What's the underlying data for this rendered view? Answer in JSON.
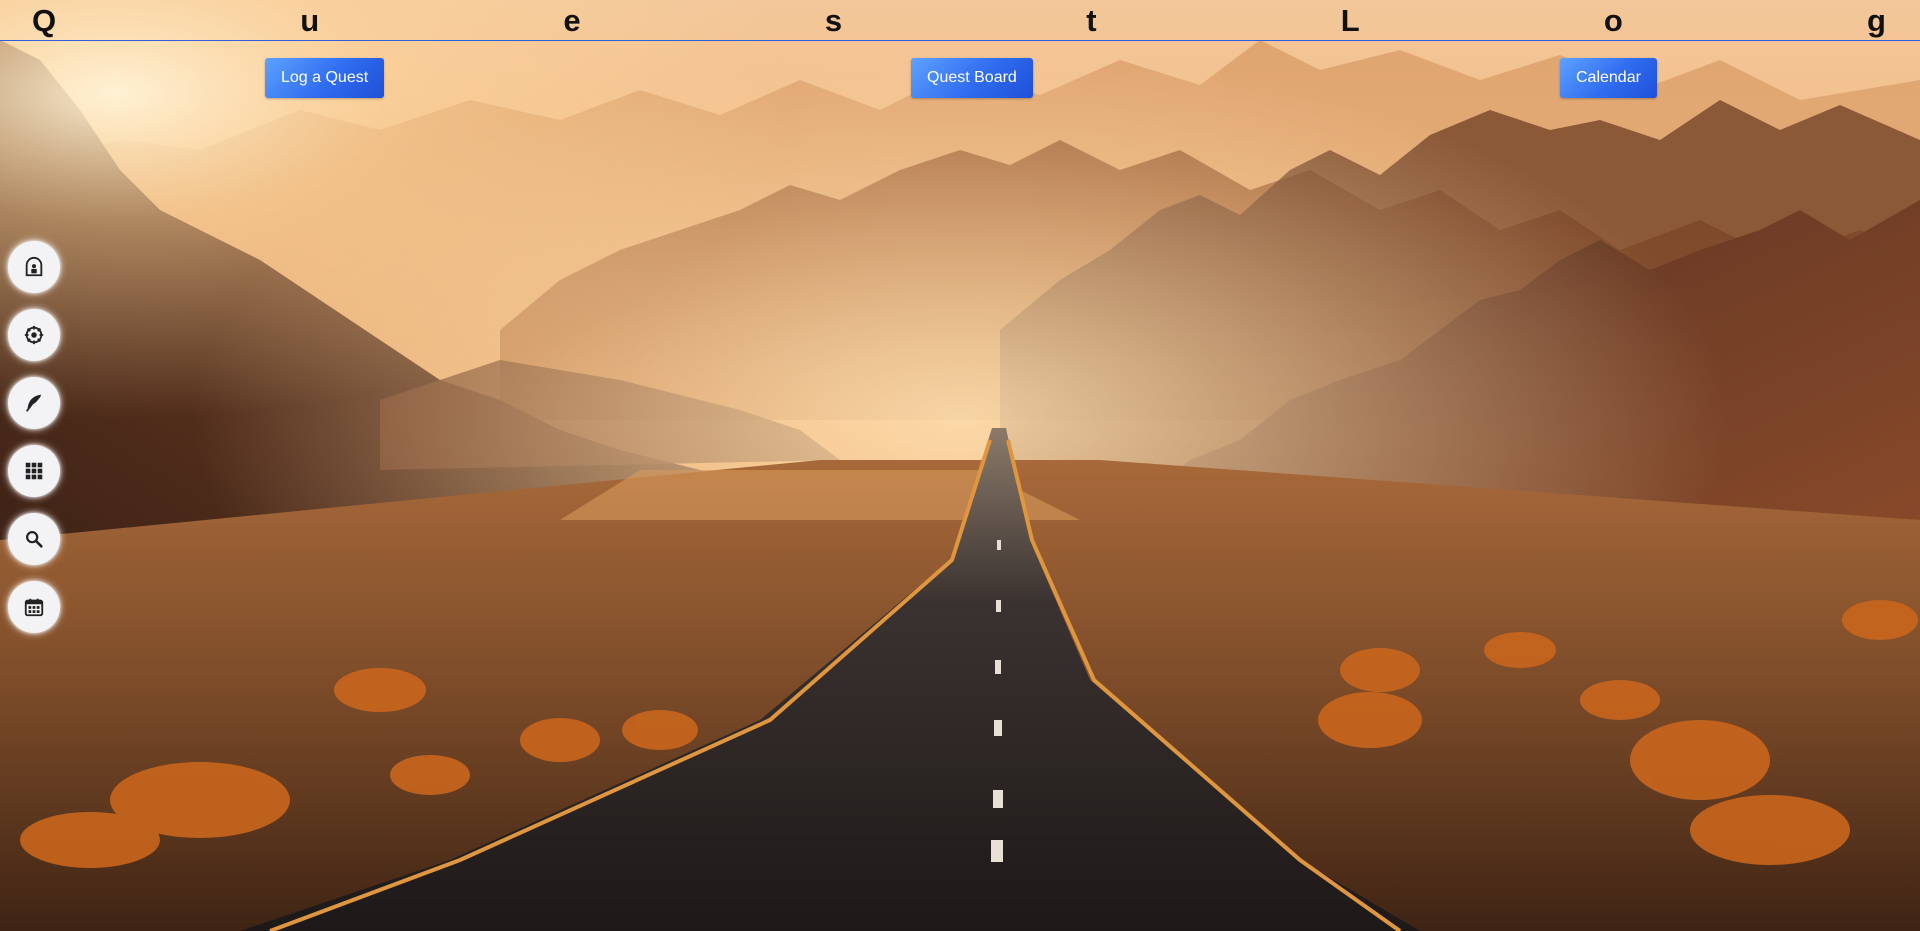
{
  "app": {
    "title_letters": [
      "Q",
      "u",
      "e",
      "s",
      "t",
      "L",
      "o",
      "g"
    ]
  },
  "nav": {
    "log_quest_label": "Log a Quest",
    "quest_board_label": "Quest Board",
    "calendar_label": "Calendar"
  },
  "sidebar": {
    "icons": [
      "quest-icon",
      "settings-icon",
      "feather-icon",
      "grid-icon",
      "search-icon",
      "calendar-icon"
    ]
  },
  "colors": {
    "button_primary": "#2f6cf0",
    "title_rule": "#2f5fe0"
  }
}
